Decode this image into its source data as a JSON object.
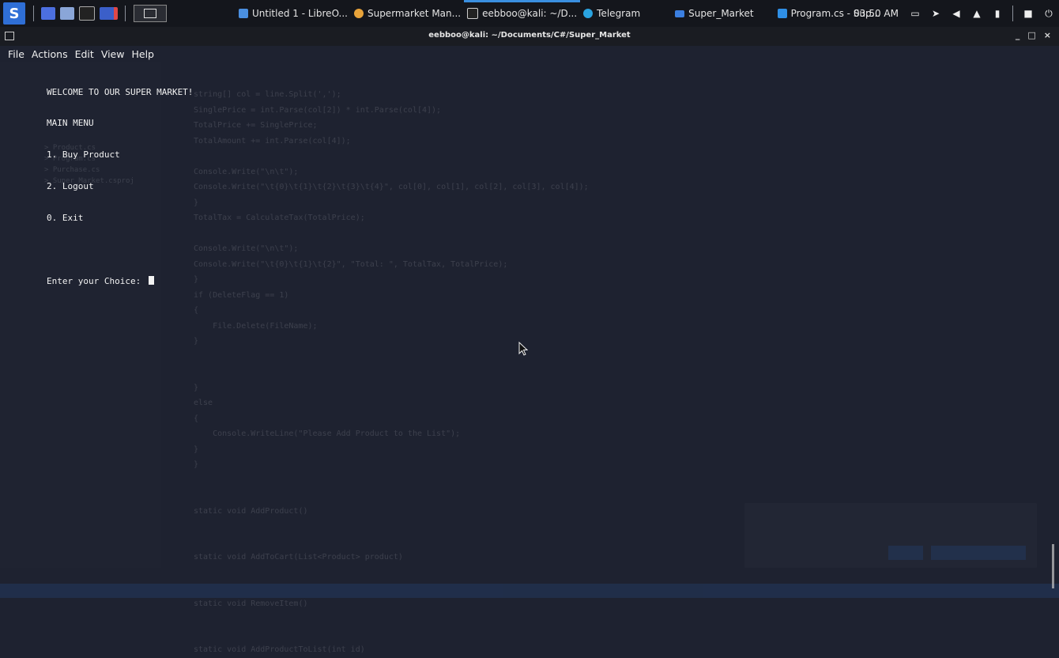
{
  "taskbar": {
    "tasks": [
      {
        "label": "Untitled 1 - LibreO...",
        "icon": "document-icon",
        "color": "#4a8fe0"
      },
      {
        "label": "Supermarket Man...",
        "icon": "chrome-icon",
        "color": "#e8a33a"
      },
      {
        "label": "eebboo@kali: ~/D...",
        "icon": "terminal-icon",
        "color": "#cccccc"
      },
      {
        "label": "Telegram",
        "icon": "telegram-icon",
        "color": "#2aa3e0"
      },
      {
        "label": "Super_Market",
        "icon": "folder-icon",
        "color": "#3b7fe0"
      },
      {
        "label": "Program.cs - Sup...",
        "icon": "vscode-icon",
        "color": "#2f8fe6"
      }
    ],
    "clock": "03:50 AM"
  },
  "window": {
    "title": "eebboo@kali: ~/Documents/C#/Super_Market",
    "minimize": "_",
    "maximize": "□",
    "close": "×"
  },
  "menu": [
    "File",
    "Actions",
    "Edit",
    "View",
    "Help"
  ],
  "terminal": {
    "lines": [
      "WELCOME TO OUR SUPER MARKET!",
      "MAIN MENU",
      "1. Buy Product",
      "2. Logout",
      "0. Exit",
      "",
      "Enter your Choice: "
    ]
  },
  "background_code": {
    "sidebar": [
      "> Product.cs",
      "> Program.cs",
      "> Purchase.cs",
      "> Super_Market.csproj"
    ],
    "lines": [
      "string[] col = line.Split(',');",
      "SinglePrice = int.Parse(col[2]) * int.Parse(col[4]);",
      "TotalPrice += SinglePrice;",
      "TotalAmount += int.Parse(col[4]);",
      "",
      "Console.Write(\"\\n\\t\");",
      "Console.Write(\"\\t{0}\\t{1}\\t{2}\\t{3}\\t{4}\", col[0], col[1], col[2], col[3], col[4]);",
      "}",
      "TotalTax = CalculateTax(TotalPrice);",
      "",
      "Console.Write(\"\\n\\t\");",
      "Console.Write(\"\\t{0}\\t{1}\\t{2}\", \"Total: \", TotalTax, TotalPrice);",
      "}",
      "if (DeleteFlag == 1)",
      "{",
      "    File.Delete(FileName);",
      "}",
      "",
      "",
      "}",
      "else",
      "{",
      "    Console.WriteLine(\"Please Add Product to the List\");",
      "}",
      "}",
      "",
      "",
      "static void AddProduct()",
      "",
      "",
      "static void AddToCart(List<Product> product)",
      "",
      "",
      "static void RemoveItem()",
      "",
      "",
      "static void AddProductToList(int id)"
    ]
  }
}
